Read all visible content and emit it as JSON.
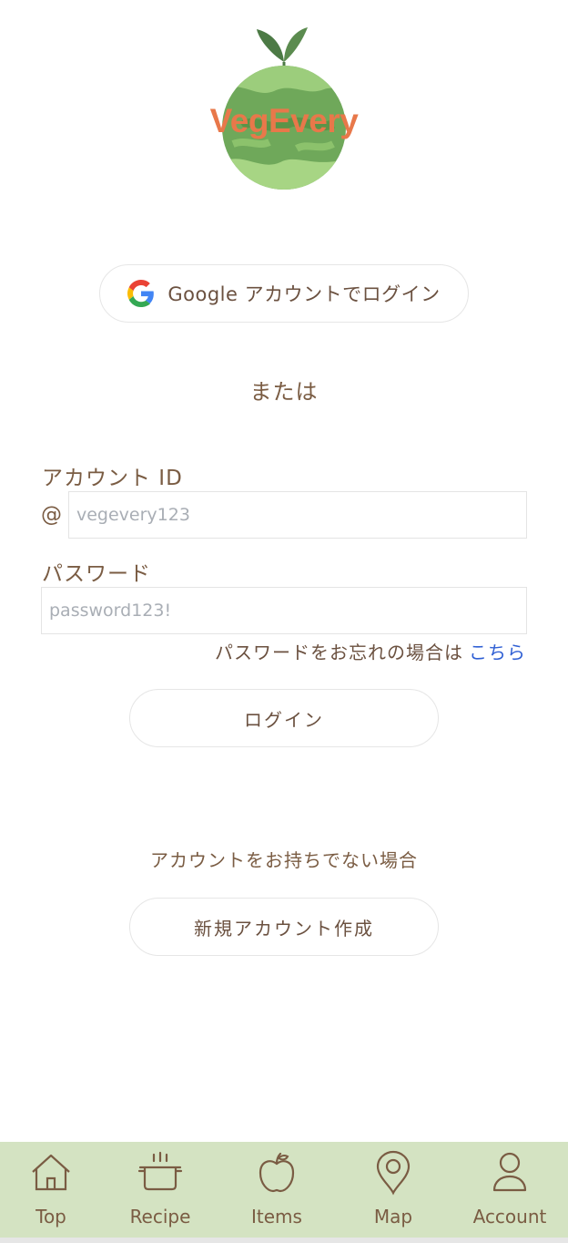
{
  "logo": {
    "text": "VegEvery"
  },
  "google_login": {
    "label": "Google アカウントでログイン"
  },
  "divider": {
    "text": "または"
  },
  "account_id": {
    "label": "アカウント ID",
    "prefix": "@",
    "placeholder": "vegevery123"
  },
  "password": {
    "label": "パスワード",
    "placeholder": "password123!"
  },
  "forgot": {
    "text": "パスワードをお忘れの場合は",
    "link": "こちら"
  },
  "login_button": {
    "label": "ログイン"
  },
  "signup": {
    "prompt": "アカウントをお持ちでない場合",
    "button": "新規アカウント作成"
  },
  "tabbar": {
    "items": [
      {
        "label": "Top",
        "icon": "house-icon"
      },
      {
        "label": "Recipe",
        "icon": "pot-icon"
      },
      {
        "label": "Items",
        "icon": "apple-icon"
      },
      {
        "label": "Map",
        "icon": "map-pin-icon"
      },
      {
        "label": "Account",
        "icon": "person-icon"
      }
    ]
  },
  "colors": {
    "text_brown": "#7a5c43",
    "link_blue": "#2f5fd4",
    "tabbar_bg": "#d4e3c2",
    "logo_orange": "#e8784a",
    "logo_green": "#6fa85a"
  }
}
